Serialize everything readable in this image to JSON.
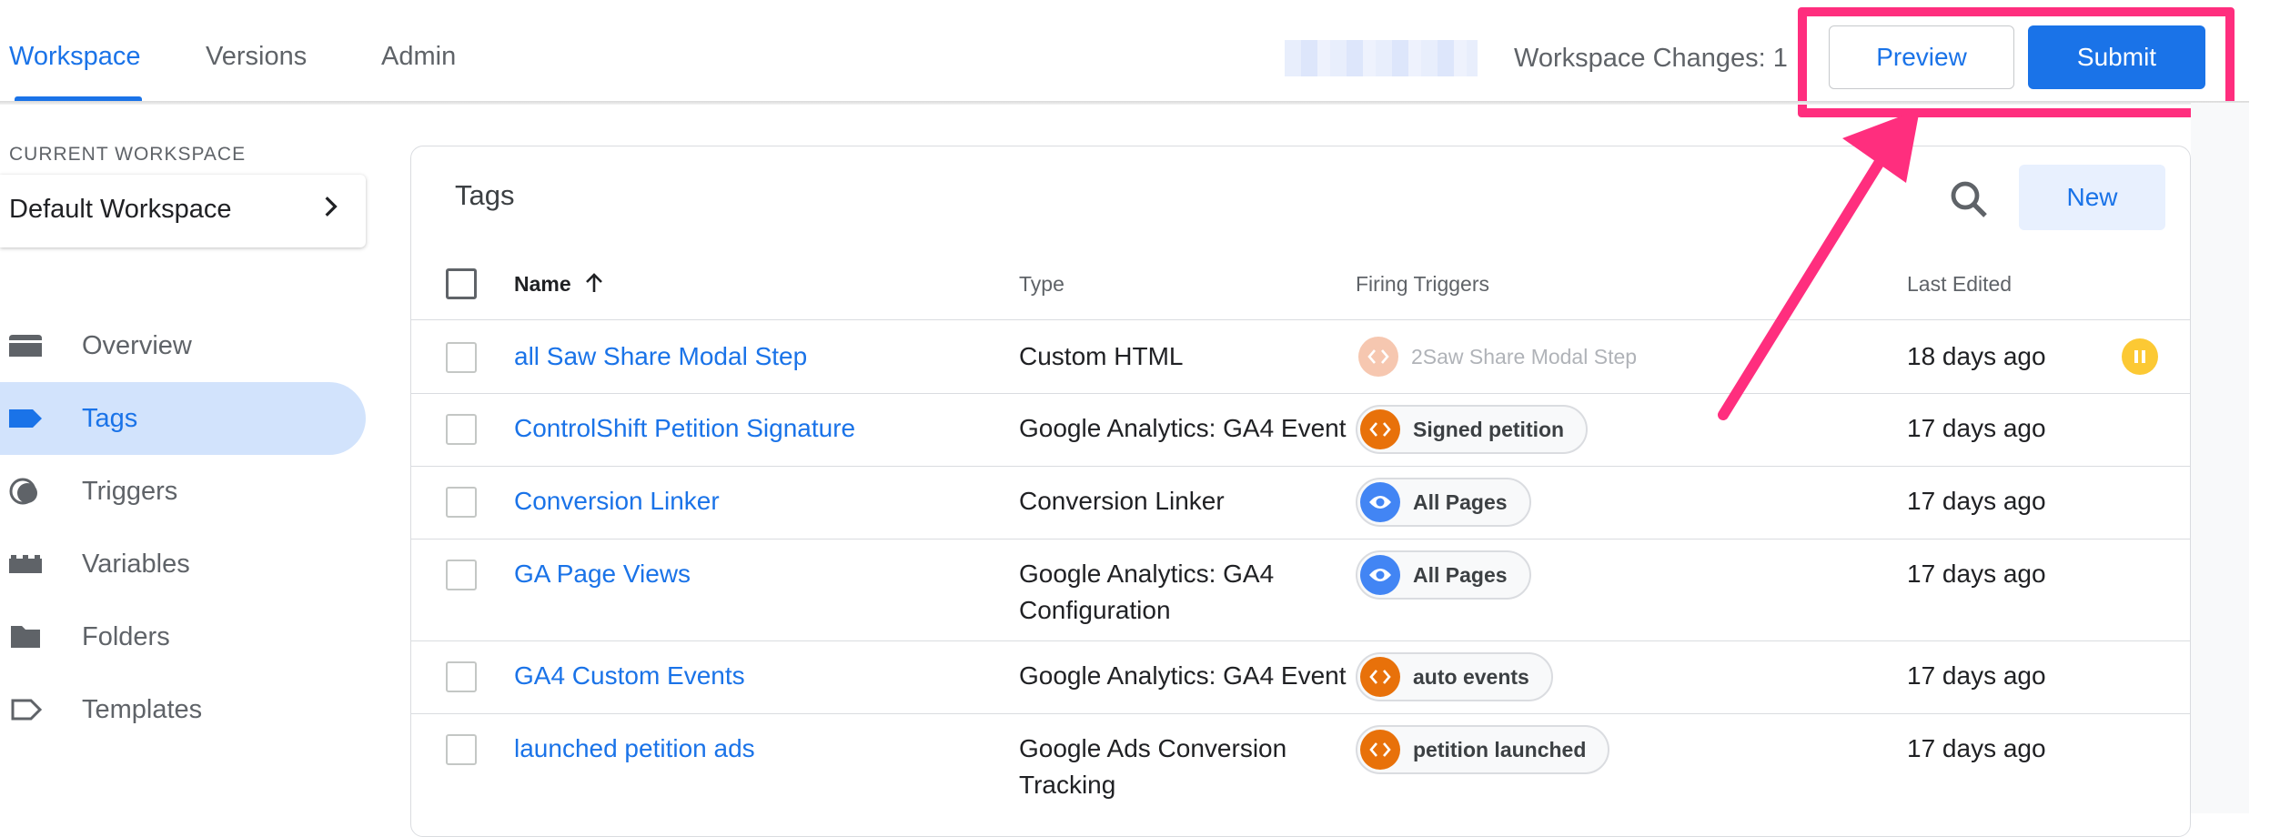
{
  "nav_tabs": [
    {
      "label": "Workspace",
      "active": true
    },
    {
      "label": "Versions",
      "active": false
    },
    {
      "label": "Admin",
      "active": false
    }
  ],
  "header": {
    "workspace_changes": "Workspace Changes: 1",
    "preview_label": "Preview",
    "submit_label": "Submit"
  },
  "sidebar": {
    "current_workspace_label": "CURRENT WORKSPACE",
    "workspace_name": "Default Workspace",
    "items": [
      {
        "label": "Overview",
        "icon": "overview-icon",
        "active": false
      },
      {
        "label": "Tags",
        "icon": "tag-icon",
        "active": true
      },
      {
        "label": "Triggers",
        "icon": "trigger-icon",
        "active": false
      },
      {
        "label": "Variables",
        "icon": "variables-icon",
        "active": false
      },
      {
        "label": "Folders",
        "icon": "folder-icon",
        "active": false
      },
      {
        "label": "Templates",
        "icon": "template-icon",
        "active": false
      }
    ]
  },
  "tags_panel": {
    "title": "Tags",
    "new_label": "New",
    "columns": {
      "name": "Name",
      "type": "Type",
      "triggers": "Firing Triggers",
      "edited": "Last Edited"
    },
    "rows": [
      {
        "name": "all Saw Share Modal Step",
        "type": "Custom HTML",
        "trigger": "2Saw Share Modal Step",
        "trigger_icon": "code-icon",
        "edited": "18 days ago",
        "paused": true
      },
      {
        "name": "ControlShift Petition Signature",
        "type": "Google Analytics: GA4 Event",
        "trigger": "Signed petition",
        "trigger_icon": "code-icon",
        "edited": "17 days ago",
        "paused": false
      },
      {
        "name": "Conversion Linker",
        "type": "Conversion Linker",
        "trigger": "All Pages",
        "trigger_icon": "eye-icon",
        "edited": "17 days ago",
        "paused": false
      },
      {
        "name": "GA Page Views",
        "type": "Google Analytics: GA4 Configuration",
        "trigger": "All Pages",
        "trigger_icon": "eye-icon",
        "edited": "17 days ago",
        "paused": false
      },
      {
        "name": "GA4 Custom Events",
        "type": "Google Analytics: GA4 Event",
        "trigger": "auto events",
        "trigger_icon": "code-icon",
        "edited": "17 days ago",
        "paused": false
      },
      {
        "name": "launched petition ads",
        "type": "Google Ads Conversion Tracking",
        "trigger": "petition launched",
        "trigger_icon": "code-icon",
        "edited": "17 days ago",
        "paused": false
      }
    ]
  },
  "colors": {
    "accent": "#1a73e8",
    "highlight": "#ff2e7e",
    "code_chip": "#e8710a",
    "eye_chip": "#4285f4",
    "paused": "#fcc934"
  }
}
